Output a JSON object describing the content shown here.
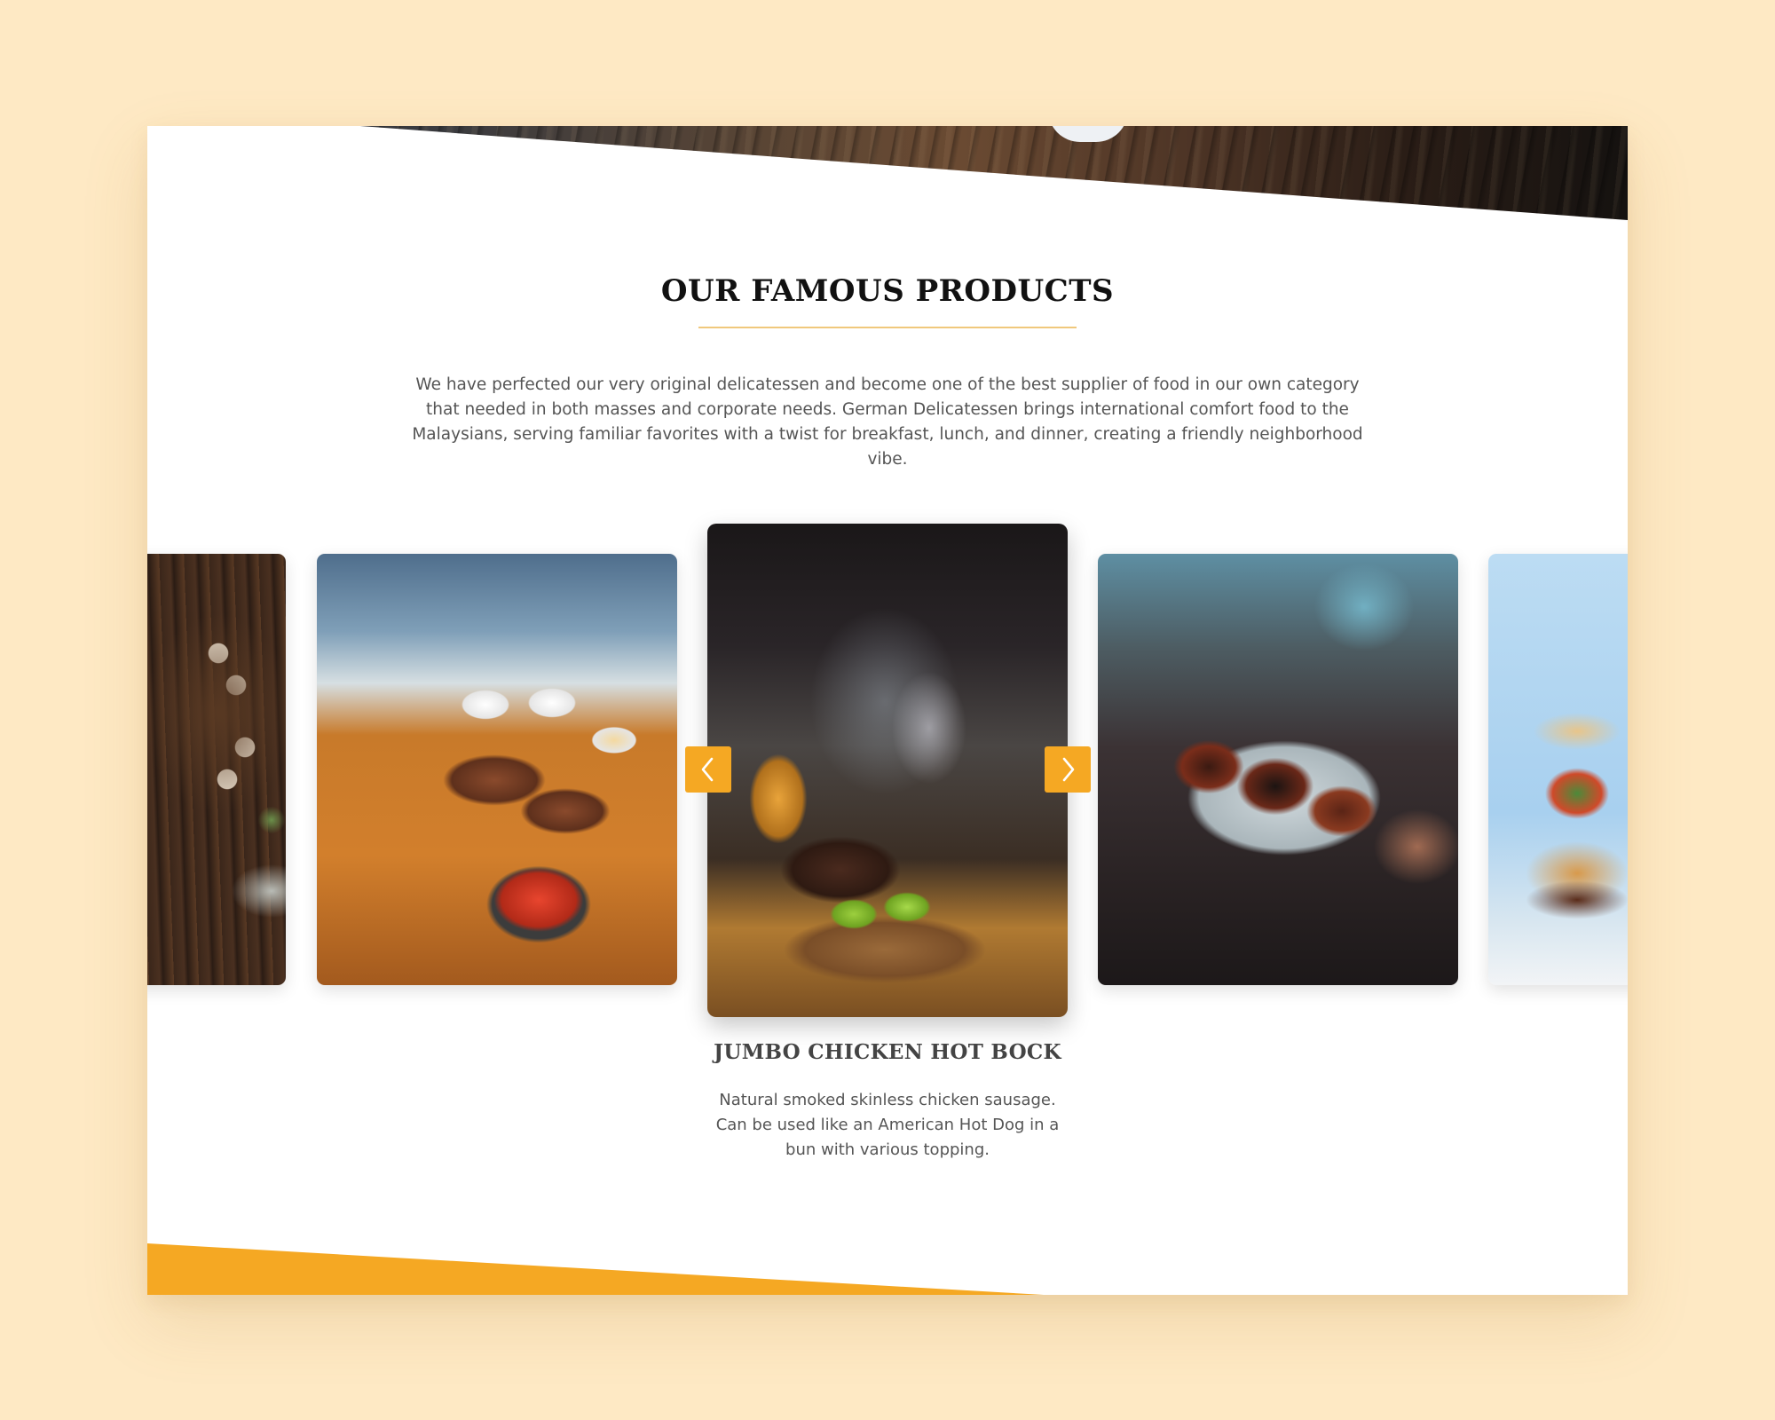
{
  "section": {
    "heading": "OUR FAMOUS PRODUCTS",
    "intro": "We have perfected our very original delicatessen and become one of the best supplier of food in our own category that needed in both masses and corporate needs. German Delicatessen brings international comfort food to the Malaysians, serving familiar favorites with a twist for breakfast, lunch, and dinner, creating a friendly neighborhood vibe."
  },
  "carousel": {
    "active_product": {
      "title": "JUMBO CHICKEN HOT BOCK",
      "description": "Natural smoked skinless chicken sausage. Can be used like an American Hot Dog in a bun with various topping."
    },
    "prev_icon": "chevron-left-icon",
    "next_icon": "chevron-right-icon"
  },
  "colors": {
    "background": "#fee9c4",
    "accent": "#f5a823",
    "heading_rule": "#f0c87c",
    "text": "#555555",
    "heading": "#111111"
  }
}
